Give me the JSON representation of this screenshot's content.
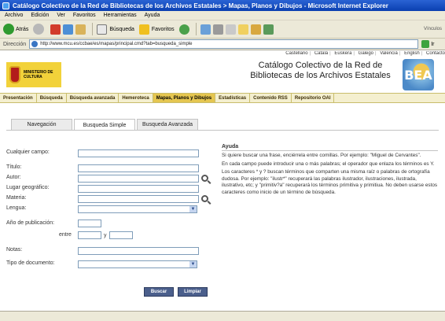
{
  "window": {
    "title": "Catálogo Colectivo de la Red de Bibliotecas de los Archivos Estatales > Mapas, Planos y Dibujos - Microsoft Internet Explorer"
  },
  "menu": [
    "Archivo",
    "Edición",
    "Ver",
    "Favoritos",
    "Herramientas",
    "Ayuda"
  ],
  "toolbar": {
    "back_label": "Atrás",
    "search_label": "Búsqueda",
    "favorites_label": "Favoritos",
    "links_label": "Vínculos"
  },
  "address": {
    "label": "Dirección",
    "url": "http://www.mcu.es/ccbae/es/mapas/principal.cmd?tab=busqueda_simple",
    "go_label": "Ir"
  },
  "languages": [
    "Castellano",
    "Català",
    "Euskera",
    "Galego",
    "Valencià",
    "English",
    "Contacto"
  ],
  "header": {
    "ministry_text": "MINISTERIO DE CULTURA",
    "catalog_title_line1": "Catálogo Colectivo de la Red de",
    "catalog_title_line2": "Bibliotecas de los Archivos Estatales",
    "logo_text": "BEA"
  },
  "nav": [
    {
      "label": "Presentación",
      "active": false
    },
    {
      "label": "Búsqueda",
      "active": false
    },
    {
      "label": "Búsqueda avanzada",
      "active": false
    },
    {
      "label": "Hemeroteca",
      "active": false
    },
    {
      "label": "Mapas, Planos y Dibujos",
      "active": true
    },
    {
      "label": "Estadísticas",
      "active": false
    },
    {
      "label": "Contenido RSS",
      "active": false
    },
    {
      "label": "Repositorio OAI",
      "active": false
    }
  ],
  "tabs": [
    {
      "label": "Navegación",
      "active": false
    },
    {
      "label": "Busqueda Simple",
      "active": true
    },
    {
      "label": "Busqueda Avanzada",
      "active": false
    }
  ],
  "form": {
    "cualquier_campo": "Cualquier campo:",
    "titulo": "Título:",
    "autor": "Autor:",
    "lugar": "Lugar geográfico:",
    "materia": "Materia:",
    "lengua": "Lengua:",
    "anio": "Año de publicación:",
    "entre": "entre",
    "y": "y",
    "notas": "Notas:",
    "tipo": "Tipo de documento:",
    "buscar": "Buscar",
    "limpiar": "Limpiar"
  },
  "help": {
    "title": "Ayuda",
    "p1": "Si quiere buscar una frase, enciérrela entre comillas. Por ejemplo: \"Miguel de Cervantes\".",
    "p2": "En cada campo puede introducir una o más palabras; el operador que enlaza los términos es Y.",
    "p3": "Los caracteres * y ? buscan términos que comparten una misma raíz o palabras de ortografía dudosa. Por ejemplo: \"ilustr*\" recuperará las palabras ilustrador, ilustraciones, ilustrada, ilustrativo, etc; y \"primitiv?a\" recuperará los términos primitiva y primitiua. No deben usarse estos caracteres como inicio de un término de búsqueda."
  }
}
